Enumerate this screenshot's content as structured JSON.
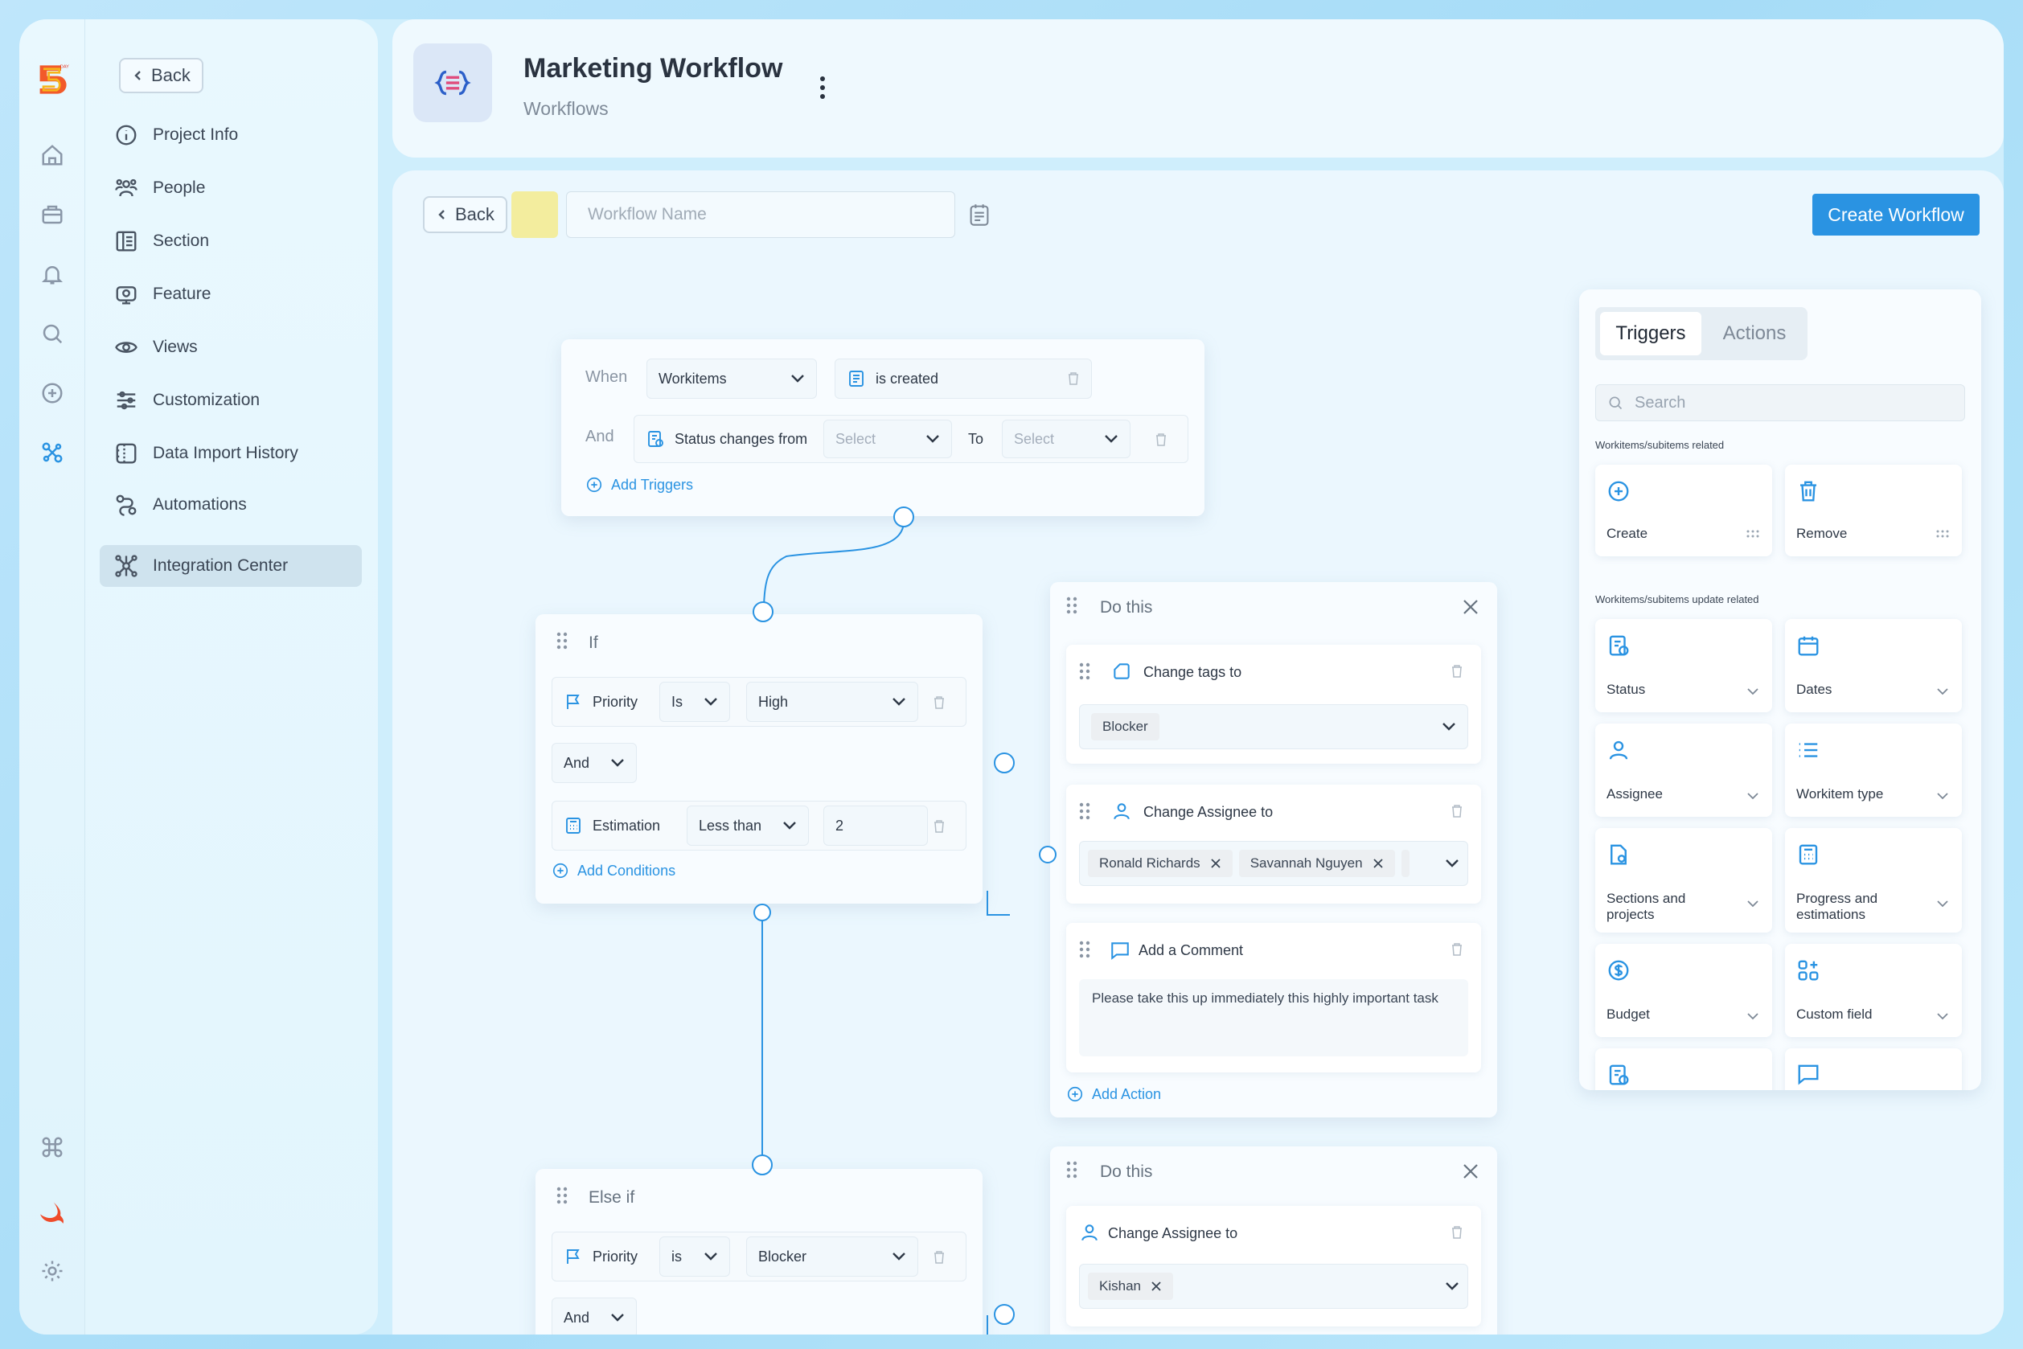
{
  "sidebar": {
    "back_label": "Back",
    "items": [
      {
        "label": "Project Info",
        "icon": "info-icon"
      },
      {
        "label": "People",
        "icon": "people-icon"
      },
      {
        "label": "Section",
        "icon": "section-icon"
      },
      {
        "label": "Feature",
        "icon": "feature-icon"
      },
      {
        "label": "Views",
        "icon": "eye-icon"
      },
      {
        "label": "Customization",
        "icon": "sliders-icon"
      },
      {
        "label": "Data Import History",
        "icon": "import-icon"
      },
      {
        "label": "Automations",
        "icon": "automation-icon"
      },
      {
        "label": "Integration Center",
        "icon": "integration-icon",
        "active": true
      }
    ]
  },
  "header": {
    "title": "Marketing Workflow",
    "subtitle": "Workflows"
  },
  "toolbar": {
    "back_label": "Back",
    "workflow_name_placeholder": "Workflow Name",
    "swatch_color": "#f3ed9e",
    "create_label": "Create Workflow"
  },
  "trigger_card": {
    "when_label": "When",
    "entity": "Workitems",
    "event": "is created",
    "and_label": "And",
    "condition": "Status changes from",
    "from_placeholder": "Select",
    "to_label": "To",
    "to_placeholder": "Select",
    "add_label": "Add Triggers"
  },
  "if_card": {
    "title": "If",
    "row1": {
      "field": "Priority",
      "operator": "Is",
      "value": "High"
    },
    "joiner": "And",
    "row2": {
      "field": "Estimation",
      "operator": "Less than",
      "value": "2"
    },
    "add_label": "Add Conditions"
  },
  "do_card_1": {
    "title": "Do this",
    "action1": {
      "label": "Change tags to",
      "value": "Blocker"
    },
    "action2": {
      "label": "Change Assignee to",
      "tags": [
        "Ronald Richards",
        "Savannah Nguyen"
      ]
    },
    "action3": {
      "label": "Add a Comment",
      "text": "Please take this up immediately this highly important task"
    },
    "add_label": "Add Action"
  },
  "elseif_card": {
    "title": "Else if",
    "row1": {
      "field": "Priority",
      "operator": "is",
      "value": "Blocker"
    },
    "joiner": "And"
  },
  "do_card_2": {
    "title": "Do this",
    "action1": {
      "label": "Change Assignee to",
      "tags": [
        "Kishan"
      ]
    }
  },
  "panel": {
    "tab_active": "Triggers",
    "tab_inactive": "Actions",
    "search_placeholder": "Search",
    "section1": "Workitems/subitems related",
    "section1_tiles": [
      {
        "label": "Create",
        "icon": "plus-circle-icon"
      },
      {
        "label": "Remove",
        "icon": "trash-icon"
      }
    ],
    "section2": "Workitems/subitems update related",
    "section2_tiles": [
      {
        "label": "Status",
        "icon": "status-icon"
      },
      {
        "label": "Dates",
        "icon": "calendar-icon"
      },
      {
        "label": "Assignee",
        "icon": "user-icon"
      },
      {
        "label": "Workitem type",
        "icon": "list-icon"
      },
      {
        "label": "Sections and projects",
        "icon": "document-icon"
      },
      {
        "label": "Progress and estimations",
        "icon": "calculator-icon"
      },
      {
        "label": "Budget",
        "icon": "dollar-icon"
      },
      {
        "label": "Custom field",
        "icon": "grid-plus-icon"
      }
    ]
  },
  "colors": {
    "accent": "#2a93e2",
    "connector": "#2a93e2"
  }
}
